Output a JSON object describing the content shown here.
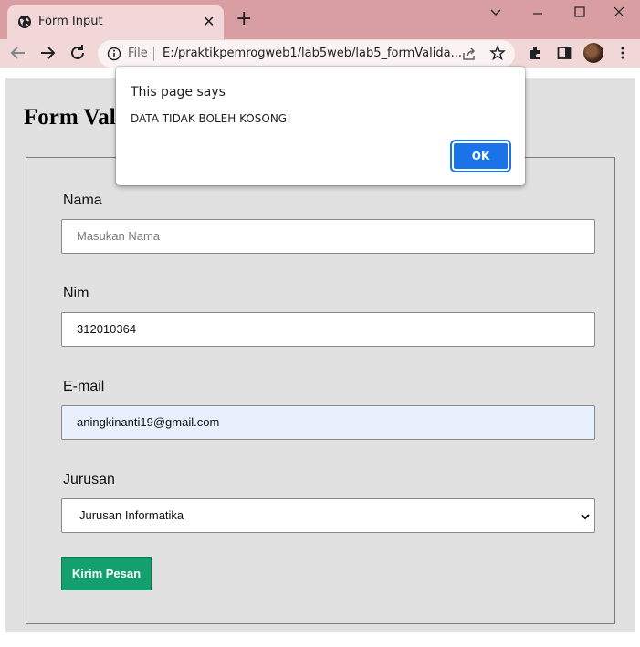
{
  "browser": {
    "tab_title": "Form Input",
    "tab_close": "✕",
    "new_tab": "+",
    "omnibox_scheme": "File",
    "omnibox_url": "E:/praktikpemrogweb1/lab5web/lab5_formValida...",
    "window_controls": {
      "minimize": "—",
      "maximize": "☐",
      "close": "✕",
      "list": "⌄"
    },
    "icons": [
      "globe-icon",
      "back-icon",
      "forward-icon",
      "reload-icon",
      "info-icon",
      "share-icon",
      "star-icon",
      "extensions-icon",
      "sidepanel-icon",
      "avatar",
      "menu-icon"
    ]
  },
  "page": {
    "heading": "Form Validasi",
    "form": {
      "nama_label": "Nama",
      "nama_placeholder": "Masukan Nama",
      "nim_label": "Nim",
      "nim_value": "312010364",
      "email_label": "E-mail",
      "email_value": "aningkinanti19@gmail.com",
      "jurusan_label": "Jurusan",
      "jurusan_value": "Jurusan Informatika",
      "submit_label": "Kirim Pesan"
    }
  },
  "dialog": {
    "title": "This page says",
    "message": "DATA TIDAK BOLEH KOSONG!",
    "ok_label": "OK"
  },
  "colors": {
    "tabstrip": "#d99ea2",
    "toolbar": "#f1d7d8",
    "submit_button": "#13a06e",
    "dialog_ok": "#1a73e8",
    "email_autofill": "#e8f0fe"
  }
}
